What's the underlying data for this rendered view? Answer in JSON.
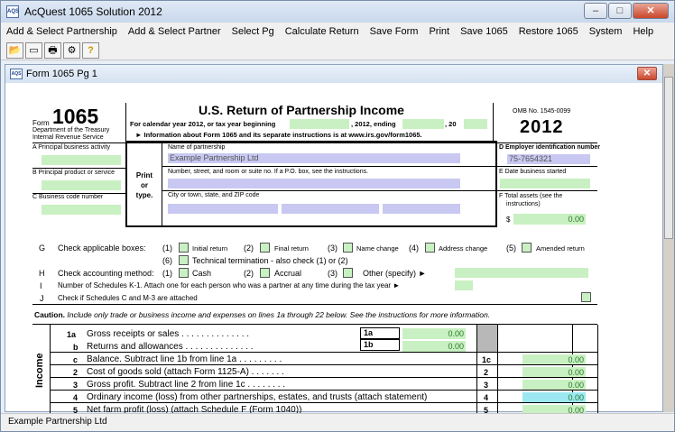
{
  "app": {
    "title": "AcQuest 1065 Solution 2012",
    "icon_text": "AQS"
  },
  "menu": [
    "Add & Select Partnership",
    "Add & Select Partner",
    "Select Pg",
    "Calculate Return",
    "Save Form",
    "Print",
    "Save 1065",
    "Restore 1065",
    "System",
    "Help"
  ],
  "toolbar": [
    "open-icon",
    "form-icon",
    "print-icon",
    "tools-icon",
    "help-icon"
  ],
  "toolbar_glyphs": [
    "📂",
    "▭",
    "🖶",
    "⚙",
    "?"
  ],
  "window": {
    "title": "Form 1065 Pg 1",
    "icon_text": "AQS",
    "close": "✕"
  },
  "form": {
    "form_word": "Form",
    "form_number": "1065",
    "dept1": "Department of the Treasury",
    "dept2": "Internal Revenue Service",
    "title": "U.S. Return of Partnership Income",
    "line1a": "For calendar year 2012, or tax year beginning",
    "line1b": ", 2012, ending",
    "line1c": ", 20",
    "line2": "► Information about Form 1065 and its separate instructions is at www.irs.gov/form1065.",
    "omb": "OMB No. 1545-0099",
    "year": "2012",
    "A": "A  Principal business activity",
    "B": "B  Principal product or service",
    "C": "C  Business code number",
    "print_or_type": "Print\nor\ntype.",
    "name_label": "Name of partnership",
    "name_value": "Example Partnership Ltd",
    "street_label": "Number, street, and room or suite no. If a P.O. box, see the instructions.",
    "city_label": "City or town, state, and ZIP code",
    "D": "D  Employer identification number",
    "ein": "75-7654321",
    "E": "E  Date business started",
    "F1": "F  Total assets (see the",
    "F2": "instructions)",
    "dollar": "$",
    "zero": "0.00"
  },
  "boxes": {
    "G": "G",
    "G_label": "Check applicable boxes:",
    "G_items": [
      {
        "n": "(1)",
        "t": "Initial return"
      },
      {
        "n": "(2)",
        "t": "Final return"
      },
      {
        "n": "(3)",
        "t": "Name change"
      },
      {
        "n": "(4)",
        "t": "Address change"
      },
      {
        "n": "(5)",
        "t": "Amended return"
      }
    ],
    "G6n": "(6)",
    "G6": "Technical termination - also check (1) or (2)",
    "H": "H",
    "H_label": "Check accounting method:",
    "H_items": [
      {
        "n": "(1)",
        "t": "Cash"
      },
      {
        "n": "(2)",
        "t": "Accrual"
      },
      {
        "n": "(3)",
        "t": "Other (specify) ►"
      }
    ],
    "I": "I",
    "I_label": "Number of Schedules K-1. Attach one for each person who was a partner at any time during the tax year ►",
    "J": "J",
    "J_label": "Check if Schedules C and M-3 are attached"
  },
  "caution": {
    "bold": "Caution.",
    "text": " Include only trade or business income and expenses on lines 1a through 22 below. See the instructions for more information."
  },
  "income": {
    "side": "Income",
    "lines": [
      {
        "no": "1a",
        "label": "Gross receipts or sales",
        "box": "1a",
        "value": "0.00"
      },
      {
        "no": "b",
        "label": "Returns and allowances",
        "box": "1b",
        "value": "0.00"
      },
      {
        "no": "c",
        "label": "Balance. Subtract line 1b from line 1a",
        "box": "1c",
        "value": "0.00"
      },
      {
        "no": "2",
        "label": "Cost of goods sold (attach Form 1125-A)",
        "box": "2",
        "value": "0.00"
      },
      {
        "no": "3",
        "label": "Gross profit. Subtract line 2 from line 1c",
        "box": "3",
        "value": "0.00"
      },
      {
        "no": "4",
        "label": "Ordinary income (loss) from other partnerships, estates, and trusts (attach statement)",
        "box": "4",
        "value": "0.00"
      },
      {
        "no": "5",
        "label": "Net farm profit (loss) (attach Schedule F (Form 1040))",
        "box": "5",
        "value": "0.00"
      }
    ]
  },
  "status": {
    "text": "Example Partnership Ltd"
  },
  "colors": {
    "field_green": "#c9f0c2",
    "field_purple": "#c8c8f2",
    "field_cyan": "#9be8f2"
  }
}
